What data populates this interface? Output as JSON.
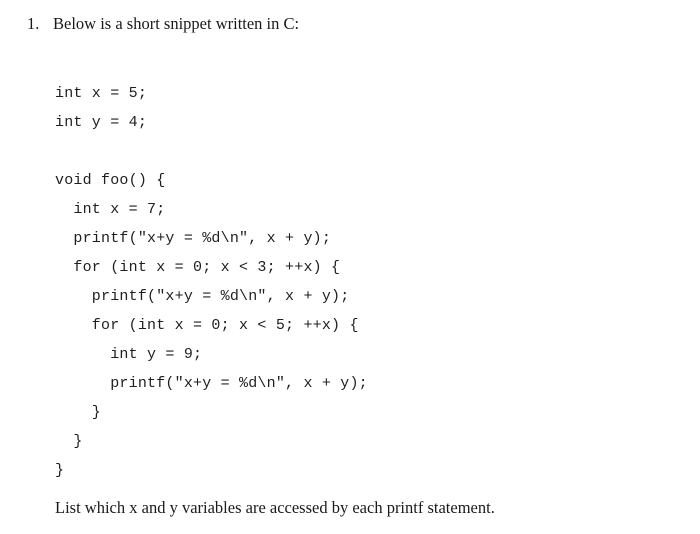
{
  "question": {
    "number": "1.",
    "prompt": "Below is a short snippet written in C:",
    "closing": "List which x and y variables are accessed by each printf statement."
  },
  "code": {
    "language": "C",
    "lines": [
      "int x = 5;",
      "int y = 4;",
      "",
      "void foo() {",
      "  int x = 7;",
      "  printf(\"x+y = %d\\n\", x + y);",
      "  for (int x = 0; x < 3; ++x) {",
      "    printf(\"x+y = %d\\n\", x + y);",
      "    for (int x = 0; x < 5; ++x) {",
      "      int y = 9;",
      "      printf(\"x+y = %d\\n\", x + y);",
      "    }",
      "  }",
      "}"
    ]
  },
  "style": {
    "background": "#ffffff",
    "text_color": "#1a1a1a",
    "code_color": "#1f1f1f"
  }
}
